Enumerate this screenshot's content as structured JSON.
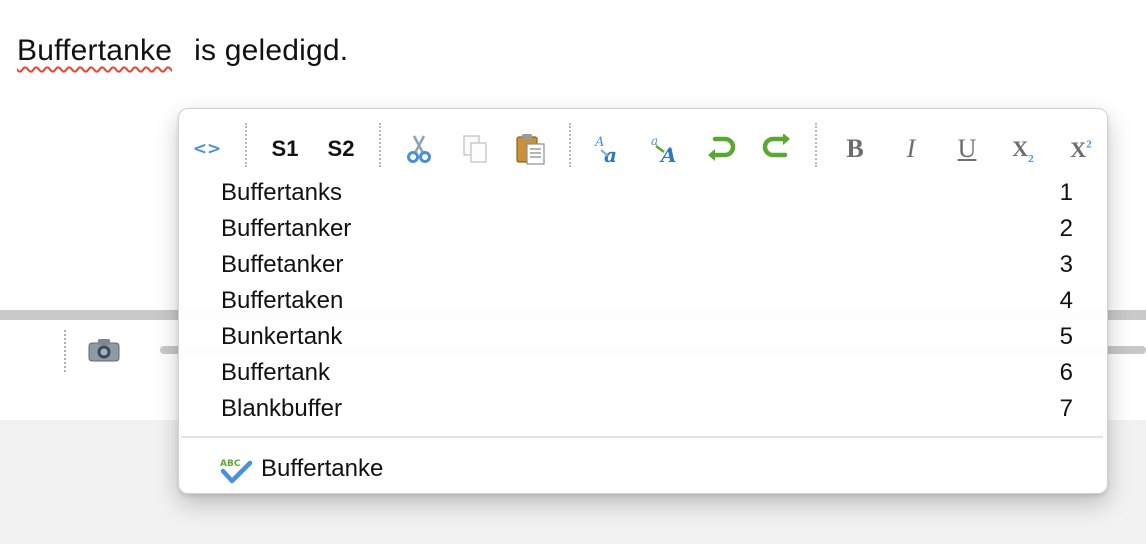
{
  "editor": {
    "misspelled_word": "Buffertanke",
    "rest_text": "is geledigd."
  },
  "background": {
    "icons": [
      "camera-icon"
    ]
  },
  "popup": {
    "toolbar": {
      "tag_toggle_label": "<>",
      "s1_label": "S1",
      "s2_label": "S2",
      "bold_label": "B",
      "italic_label": "I",
      "underline_label": "U",
      "subscript_label": "X",
      "subscript_mark": "2",
      "superscript_label": "X",
      "superscript_mark": "2",
      "icons": [
        "cut-icon",
        "copy-icon",
        "paste-icon",
        "find-icon",
        "replace-icon",
        "undo-icon",
        "redo-icon"
      ]
    },
    "suggestions": [
      {
        "word": "Buffertanks",
        "shortcut": "1"
      },
      {
        "word": "Buffertanker",
        "shortcut": "2"
      },
      {
        "word": "Buffetanker",
        "shortcut": "3"
      },
      {
        "word": "Buffertaken",
        "shortcut": "4"
      },
      {
        "word": "Bunkertank",
        "shortcut": "5"
      },
      {
        "word": "Buffertank",
        "shortcut": "6"
      },
      {
        "word": "Blankbuffer",
        "shortcut": "7"
      }
    ],
    "add_to_dictionary": {
      "icon": "spellcheck-abc-icon",
      "icon_text": "ABC",
      "word": "Buffertanke"
    }
  },
  "colors": {
    "toolbar_blue": "#4a90d9",
    "toolbar_green": "#5aa832",
    "spell_underline": "#e0473a",
    "paste_orange": "#c8913a"
  }
}
